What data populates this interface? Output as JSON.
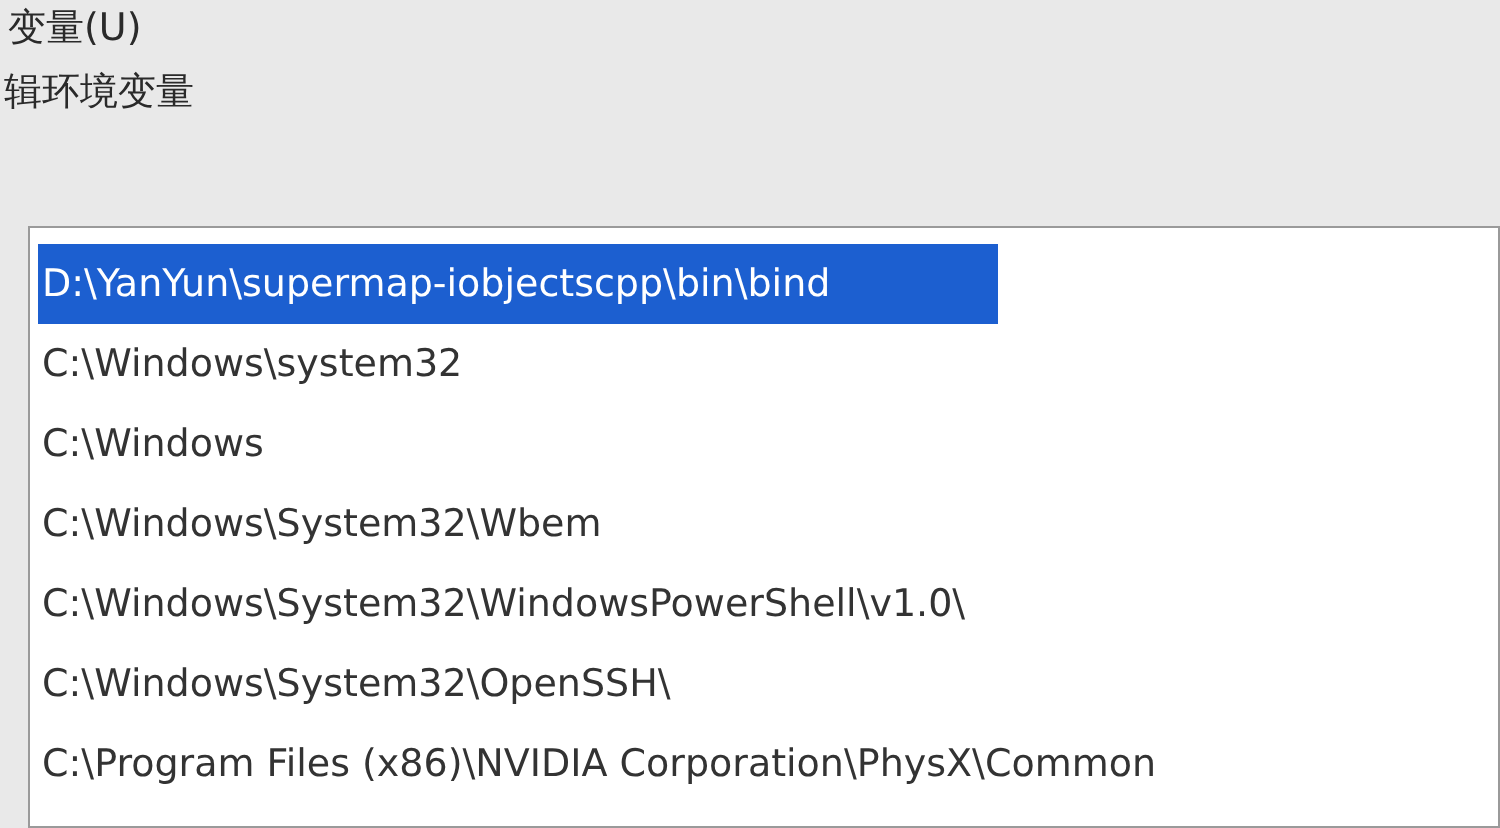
{
  "header_label": "变量(U)",
  "dialog_title": "辑环境变量",
  "path_list": [
    {
      "text": "D:\\YanYun\\supermap-iobjectscpp\\bin\\bind",
      "selected": true
    },
    {
      "text": "C:\\Windows\\system32",
      "selected": false
    },
    {
      "text": "C:\\Windows",
      "selected": false
    },
    {
      "text": "C:\\Windows\\System32\\Wbem",
      "selected": false
    },
    {
      "text": "C:\\Windows\\System32\\WindowsPowerShell\\v1.0\\",
      "selected": false
    },
    {
      "text": "C:\\Windows\\System32\\OpenSSH\\",
      "selected": false
    },
    {
      "text": "C:\\Program Files (x86)\\NVIDIA Corporation\\PhysX\\Common",
      "selected": false
    }
  ]
}
